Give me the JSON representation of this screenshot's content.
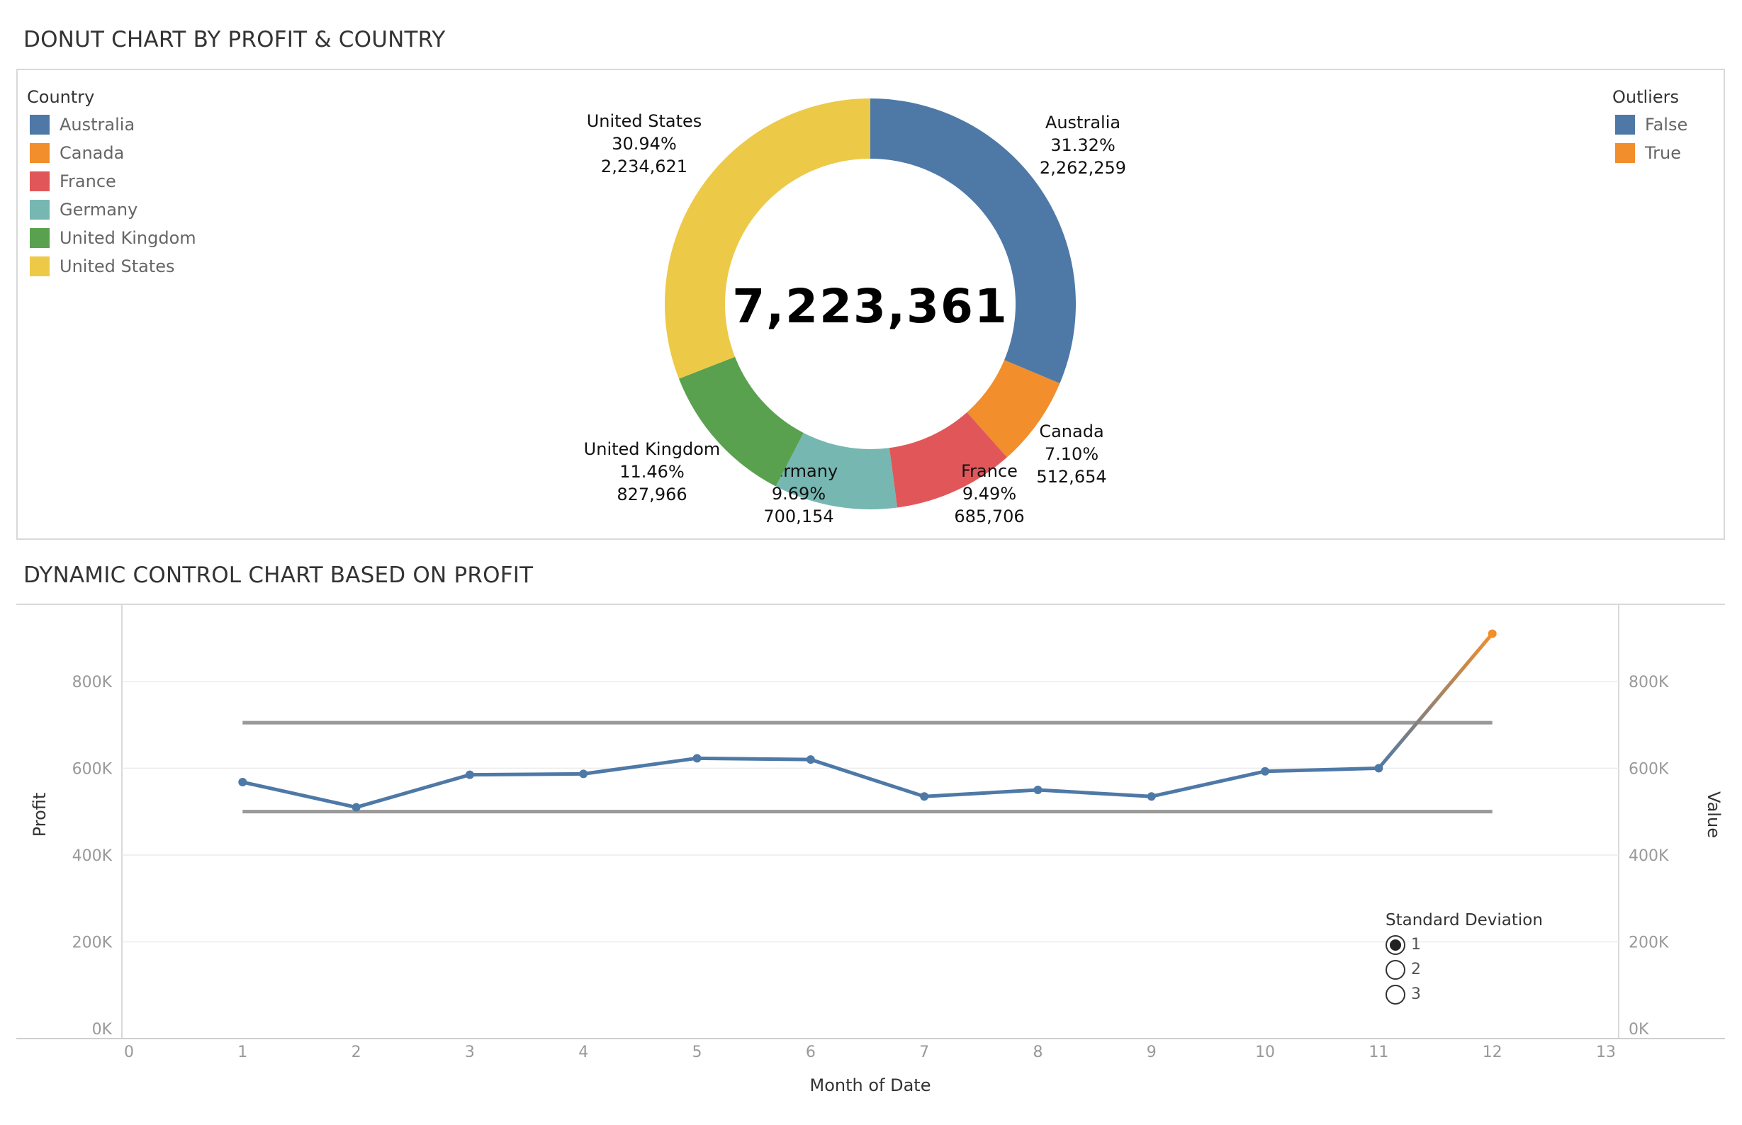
{
  "top": {
    "title": "DONUT CHART BY PROFIT & COUNTRY"
  },
  "bottom": {
    "title": "DYNAMIC CONTROL CHART BASED ON PROFIT"
  },
  "legend_country": {
    "title": "Country",
    "items": [
      {
        "label": "Australia",
        "color": "#4e79a7"
      },
      {
        "label": "Canada",
        "color": "#f28e2b"
      },
      {
        "label": "France",
        "color": "#e15759"
      },
      {
        "label": "Germany",
        "color": "#76b7b2"
      },
      {
        "label": "United Kingdom",
        "color": "#59a14f"
      },
      {
        "label": "United States",
        "color": "#edc948"
      }
    ]
  },
  "legend_outliers": {
    "title": "Outliers",
    "items": [
      {
        "label": "False",
        "color": "#4e79a7"
      },
      {
        "label": "True",
        "color": "#f28e2b"
      }
    ]
  },
  "control": {
    "title": "Standard Deviation",
    "options": [
      "1",
      "2",
      "3"
    ],
    "selected": "1"
  },
  "chart_data": [
    {
      "type": "pie",
      "variant": "donut",
      "center_label": "7,223,361",
      "slices": [
        {
          "label": "Australia",
          "percent": "31.32%",
          "value": 2262259,
          "value_label": "2,262,259",
          "color": "#4e79a7"
        },
        {
          "label": "Canada",
          "percent": "7.10%",
          "value": 512654,
          "value_label": "512,654",
          "color": "#f28e2b"
        },
        {
          "label": "France",
          "percent": "9.49%",
          "value": 685706,
          "value_label": "685,706",
          "color": "#e15759"
        },
        {
          "label": "Germany",
          "percent": "9.69%",
          "value": 700154,
          "value_label": "700,154",
          "color": "#76b7b2"
        },
        {
          "label": "United Kingdom",
          "percent": "11.46%",
          "value": 827966,
          "value_label": "827,966",
          "color": "#59a14f"
        },
        {
          "label": "United States",
          "percent": "30.94%",
          "value": 2234621,
          "value_label": "2,234,621",
          "color": "#edc948"
        }
      ]
    },
    {
      "type": "line",
      "xlabel": "Month of Date",
      "ylabel": "Profit",
      "ylabel_right": "Value",
      "x": [
        1,
        2,
        3,
        4,
        5,
        6,
        7,
        8,
        9,
        10,
        11,
        12
      ],
      "series": [
        {
          "values": [
            568000,
            510000,
            585000,
            587000,
            623000,
            620000,
            535000,
            550000,
            535000,
            593000,
            600000,
            910000
          ],
          "outlier": [
            false,
            false,
            false,
            false,
            false,
            false,
            false,
            false,
            false,
            false,
            false,
            true
          ]
        }
      ],
      "control_limits": {
        "upper": 705000,
        "lower": 500000
      },
      "xlim": [
        0,
        13
      ],
      "ylim": [
        0,
        950000
      ],
      "x_ticks": [
        "0",
        "1",
        "2",
        "3",
        "4",
        "5",
        "6",
        "7",
        "8",
        "9",
        "10",
        "11",
        "12",
        "13"
      ],
      "y_ticks": [
        {
          "value": 0,
          "label": "0K"
        },
        {
          "value": 200000,
          "label": "200K"
        },
        {
          "value": 400000,
          "label": "400K"
        },
        {
          "value": 600000,
          "label": "600K"
        },
        {
          "value": 800000,
          "label": "800K"
        }
      ],
      "colors": {
        "normal": "#4e79a7",
        "outlier": "#f28e2b",
        "limits": "#999999",
        "grid": "#ececec"
      },
      "grid": true
    }
  ]
}
